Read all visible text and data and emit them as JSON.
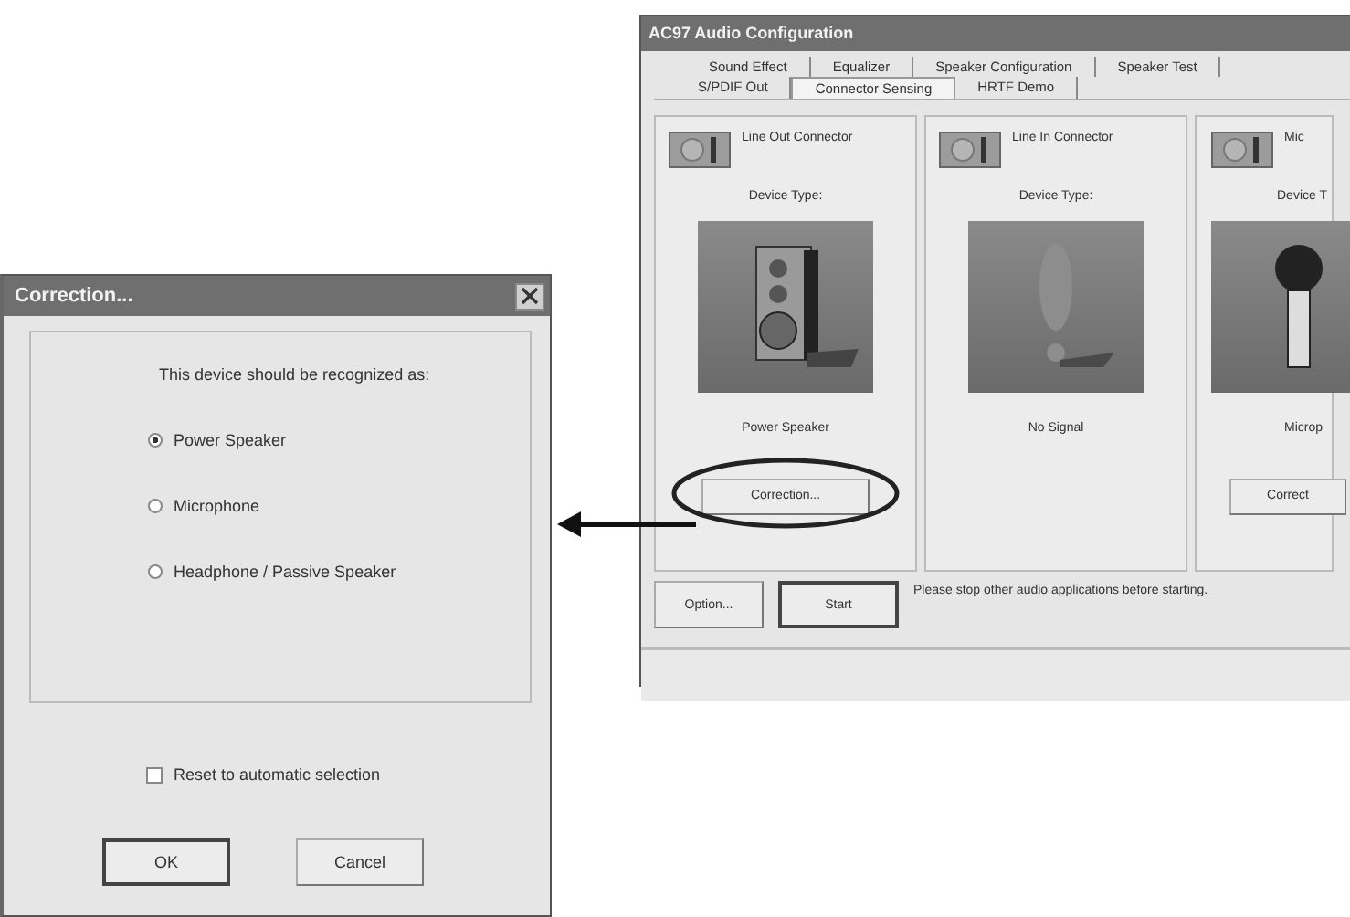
{
  "main_window": {
    "title": "AC97 Audio Configuration",
    "tab_rows": [
      [
        {
          "label": "Sound Effect",
          "selected": false
        },
        {
          "label": "Equalizer",
          "selected": false
        },
        {
          "label": "Speaker Configuration",
          "selected": false
        },
        {
          "label": "Speaker Test",
          "selected": false
        }
      ],
      [
        {
          "label": "S/PDIF Out",
          "selected": false
        },
        {
          "label": "Connector Sensing",
          "selected": true
        },
        {
          "label": "HRTF Demo",
          "selected": false
        }
      ]
    ],
    "connectors": [
      {
        "kind": "speaker",
        "title": "Line Out Connector",
        "type_label": "Device Type:",
        "device": "Power Speaker",
        "button": "Correction...",
        "circled": true
      },
      {
        "kind": "nosignal",
        "title": "Line In Connector",
        "type_label": "Device Type:",
        "device": "No Signal"
      },
      {
        "kind": "microphone",
        "title": "Mic",
        "type_label": "Device T",
        "device": "Microp",
        "button": "Correct",
        "circled": false
      }
    ],
    "buttons": [
      {
        "label": "Option...",
        "default": false
      },
      {
        "label": "Start",
        "default": true
      }
    ],
    "message": "Please stop other audio applications before starting."
  },
  "dialog": {
    "title": "Correction...",
    "prompt": "This device should be recognized as:",
    "options": [
      {
        "label": "Power Speaker",
        "selected": true
      },
      {
        "label": "Microphone",
        "selected": false
      },
      {
        "label": "Headphone / Passive Speaker",
        "selected": false
      }
    ],
    "reset": {
      "label": "Reset to automatic selection",
      "checked": false
    },
    "buttons": [
      {
        "label": "OK",
        "default": true
      },
      {
        "label": "Cancel",
        "default": false
      }
    ]
  }
}
